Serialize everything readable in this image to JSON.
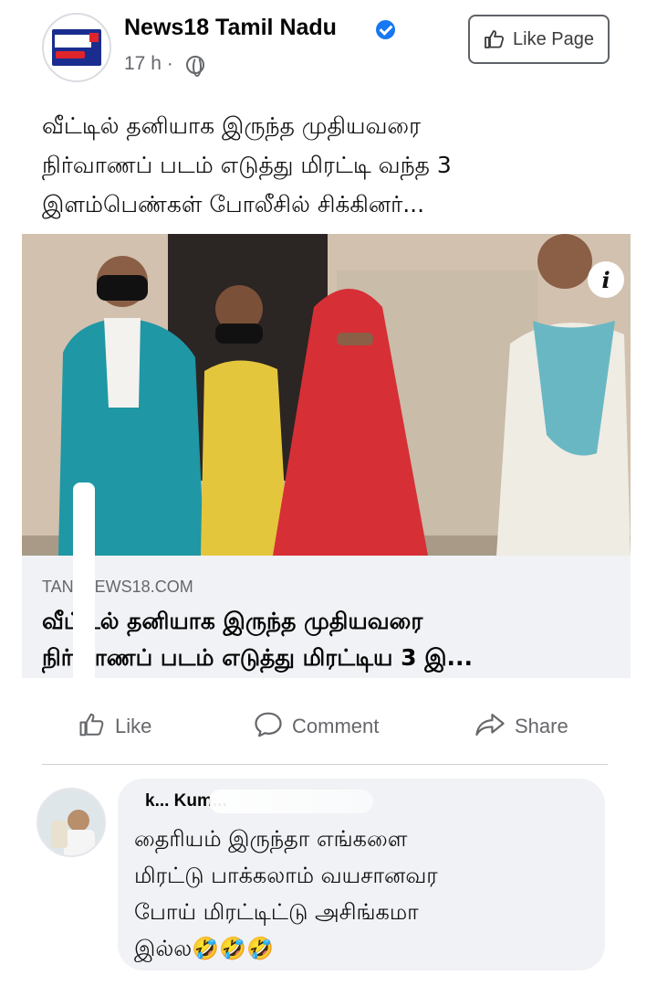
{
  "post": {
    "page_name": "News18 Tamil Nadu",
    "time": "17 h ·",
    "like_page_label": "Like Page",
    "text_lines": [
      "வீட்டில் தனியாக இருந்த முதியவரை",
      "நிர்வாணப் படம் எடுத்து மிரட்டி வந்த 3",
      "இளம்பெண்கள் போலீசில் சிக்கினர்..."
    ],
    "info_label": "i"
  },
  "link_preview": {
    "domain": "TAN..NEWS18.COM",
    "title_lines": [
      "வீட்டில் தனியாக இருந்த முதியவரை",
      "நிர்வாணப் படம் எடுத்து மிரட்டிய 3 இ..."
    ]
  },
  "actions": {
    "like": "Like",
    "comment": "Comment",
    "share": "Share"
  },
  "comment": {
    "author": "k... Kum...",
    "text_lines": [
      "தைரியம் இருந்தா எங்களை",
      "மிரட்டு பாக்கலாம் வயசானவர",
      "போய் மிரட்டிட்டு அசிங்கமா",
      "இல்ல🤣🤣🤣"
    ]
  },
  "colors": {
    "brand_blue": "#1877f2",
    "secondary_text": "#65676b",
    "bubble_bg": "#f0f2f5"
  }
}
